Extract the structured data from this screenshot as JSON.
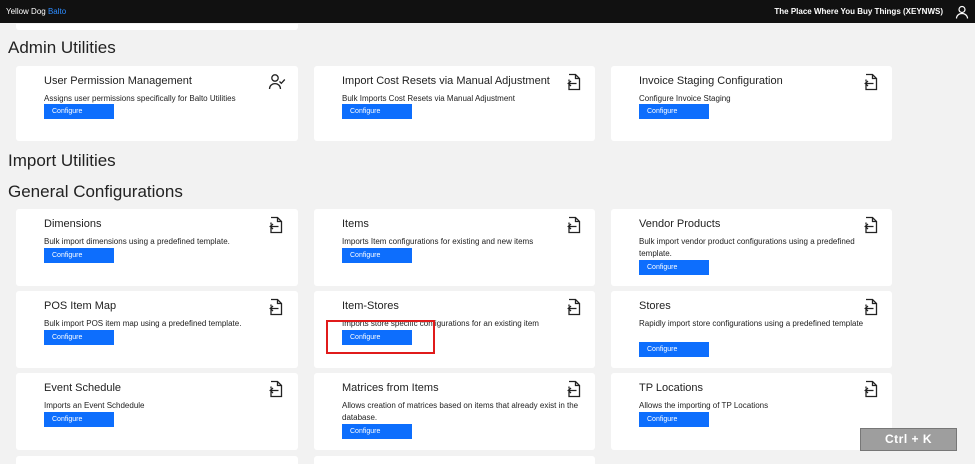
{
  "topbar": {
    "brand_main": "Yellow Dog",
    "brand_accent": "Balto",
    "store_name": "The Place Where You Buy Things (XEYNWS)"
  },
  "sections": {
    "admin_utilities": "Admin Utilities",
    "import_utilities": "Import Utilities",
    "general_configurations": "General Configurations"
  },
  "cards": {
    "user_permission": {
      "title": "User Permission Management",
      "desc": "Assigns user permissions specifically for Balto Utilities",
      "button": "Configure",
      "icon": "user-check-icon"
    },
    "import_cost_resets": {
      "title": "Import Cost Resets via Manual Adjustment",
      "desc": "Bulk Imports Cost Resets via Manual Adjustment",
      "button": "Configure",
      "icon": "file-import-icon"
    },
    "invoice_staging": {
      "title": "Invoice Staging Configuration",
      "desc": "Configure Invoice Staging",
      "button": "Configure",
      "icon": "file-import-icon"
    },
    "dimensions": {
      "title": "Dimensions",
      "desc": "Bulk import dimensions using a predefined template.",
      "button": "Configure",
      "icon": "file-import-icon"
    },
    "items": {
      "title": "Items",
      "desc": "Imports Item configurations for existing and new items",
      "button": "Configure",
      "icon": "file-import-icon"
    },
    "vendor_products": {
      "title": "Vendor Products",
      "desc": "Bulk import vendor product configurations using a predefined template.",
      "button": "Configure",
      "icon": "file-import-icon"
    },
    "pos_item_map": {
      "title": "POS Item Map",
      "desc": "Bulk import POS item map using a predefined template.",
      "button": "Configure",
      "icon": "file-import-icon"
    },
    "item_stores": {
      "title": "Item-Stores",
      "desc": "Imports store specific configurations for an existing item",
      "button": "Configure",
      "icon": "file-import-icon"
    },
    "stores": {
      "title": "Stores",
      "desc": "Rapidly import store configurations using a predefined template",
      "button": "Configure",
      "icon": "file-import-icon"
    },
    "event_schedule": {
      "title": "Event Schedule",
      "desc": "Imports an Event Schdedule",
      "button": "Configure",
      "icon": "file-import-icon"
    },
    "matrices_from_items": {
      "title": "Matrices from Items",
      "desc": "Allows creation of matrices based on items that already exist in the database.",
      "button": "Configure",
      "icon": "file-import-icon"
    },
    "tp_locations": {
      "title": "TP Locations",
      "desc": "Allows the importing of TP Locations",
      "button": "Configure",
      "icon": "file-import-icon"
    }
  },
  "keyboard_hint": "Ctrl + K",
  "colors": {
    "topbar": "#111111",
    "accent": "#2d8cff",
    "button": "#0d6efd",
    "highlight": "#e01b1b",
    "background": "#f2f2f2"
  }
}
